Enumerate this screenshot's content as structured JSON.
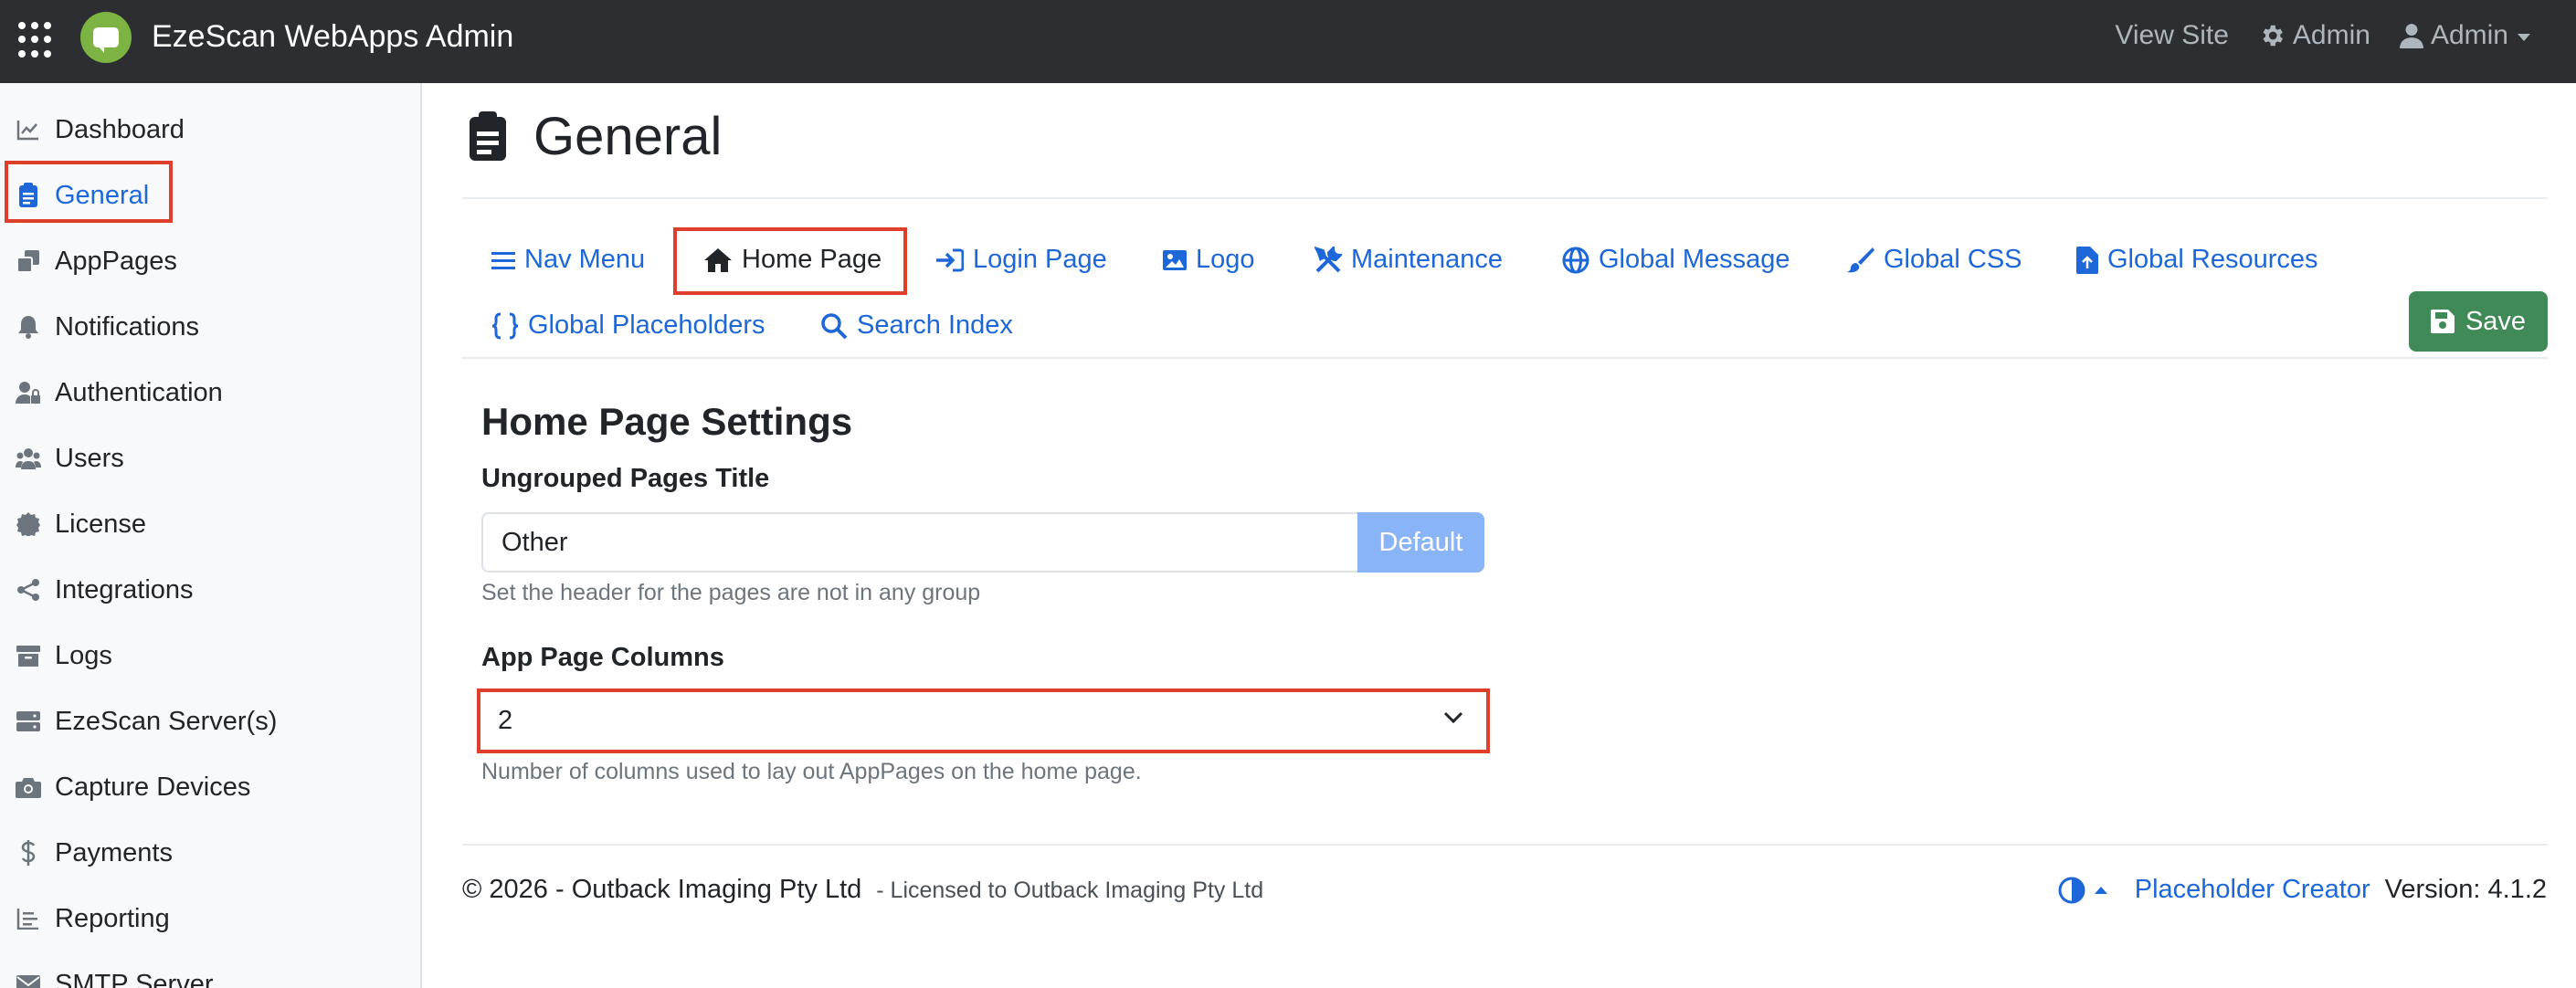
{
  "colors": {
    "accent": "#1d67d8",
    "navbar": "#2c2e31",
    "highlight": "#e03e2d",
    "save": "#3f8a57",
    "default_btn": "#8ab4f8"
  },
  "header": {
    "app_title": "EzeScan WebApps Admin",
    "view_site": "View Site",
    "admin_settings": "Admin",
    "user_menu": "Admin"
  },
  "sidebar": {
    "items": [
      {
        "label": "Dashboard",
        "icon": "chart-line-icon"
      },
      {
        "label": "General",
        "icon": "clipboard-icon",
        "active": true
      },
      {
        "label": "AppPages",
        "icon": "copy-icon"
      },
      {
        "label": "Notifications",
        "icon": "bell-icon"
      },
      {
        "label": "Authentication",
        "icon": "user-lock-icon"
      },
      {
        "label": "Users",
        "icon": "users-icon"
      },
      {
        "label": "License",
        "icon": "certificate-icon"
      },
      {
        "label": "Integrations",
        "icon": "share-icon"
      },
      {
        "label": "Logs",
        "icon": "archive-icon"
      },
      {
        "label": "EzeScan Server(s)",
        "icon": "server-icon"
      },
      {
        "label": "Capture Devices",
        "icon": "camera-icon"
      },
      {
        "label": "Payments",
        "icon": "dollar-icon"
      },
      {
        "label": "Reporting",
        "icon": "list-icon"
      },
      {
        "label": "SMTP Server",
        "icon": "envelope-icon"
      }
    ]
  },
  "main": {
    "page_title": "General",
    "tabs": [
      {
        "label": "Nav Menu",
        "icon": "bars-icon"
      },
      {
        "label": "Home Page",
        "icon": "home-icon",
        "active": true
      },
      {
        "label": "Login Page",
        "icon": "sign-in-icon"
      },
      {
        "label": "Logo",
        "icon": "image-icon"
      },
      {
        "label": "Maintenance",
        "icon": "tools-icon"
      },
      {
        "label": "Global Message",
        "icon": "globe-icon"
      },
      {
        "label": "Global CSS",
        "icon": "brush-icon"
      },
      {
        "label": "Global Resources",
        "icon": "file-upload-icon"
      },
      {
        "label": "Global Placeholders",
        "icon": "braces-icon"
      },
      {
        "label": "Search Index",
        "icon": "search-icon"
      }
    ],
    "save_label": "Save",
    "section_title": "Home Page Settings",
    "ungrouped": {
      "label": "Ungrouped Pages Title",
      "value": "Other",
      "default_button": "Default",
      "help": "Set the header for the pages are not in any group"
    },
    "columns": {
      "label": "App Page Columns",
      "value": "2",
      "help": "Number of columns used to lay out AppPages on the home page."
    }
  },
  "footer": {
    "copyright": "© 2026 - Outback Imaging Pty Ltd",
    "licensed": "- Licensed to Outback Imaging Pty Ltd",
    "placeholder_creator": "Placeholder Creator",
    "version": "Version: 4.1.2"
  }
}
